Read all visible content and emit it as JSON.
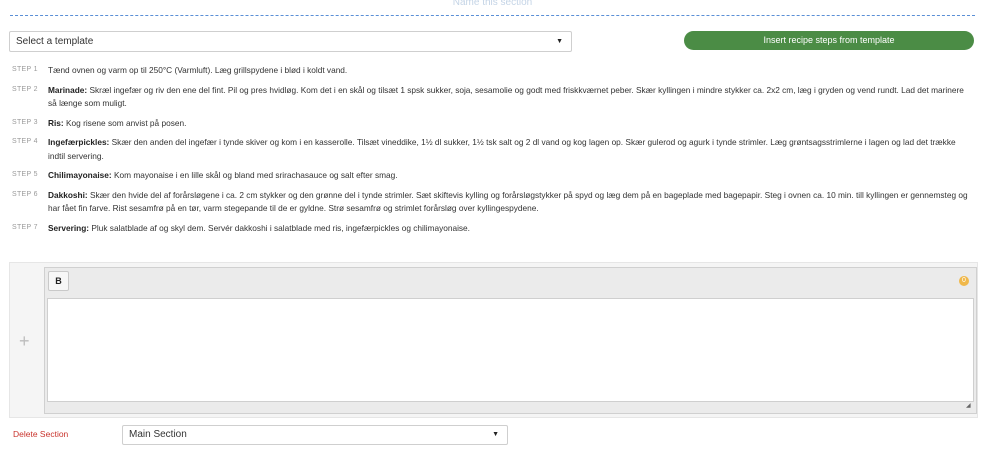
{
  "section": {
    "name_placeholder": "Name this section"
  },
  "template": {
    "selected": "Select a template",
    "insert_label": "Insert recipe steps from template"
  },
  "steps": [
    {
      "label": "STEP 1",
      "title": "",
      "text": "Tænd ovnen og varm op til 250°C (Varmluft). Læg grillspydene i blød i koldt vand."
    },
    {
      "label": "STEP 2",
      "title": "Marinade:",
      "text": "Skræl ingefær og riv den ene del fint. Pil og pres hvidløg. Kom det i en skål og tilsæt 1 spsk sukker, soja, sesamolie og godt med friskkværnet peber. Skær kyllingen i mindre stykker ca. 2x2 cm, læg i gryden og vend rundt. Lad det marinere så længe som muligt."
    },
    {
      "label": "STEP 3",
      "title": "Ris:",
      "text": "Kog risene som anvist på posen."
    },
    {
      "label": "STEP 4",
      "title": "Ingefærpickles:",
      "text": "Skær den anden del ingefær i tynde skiver og kom i en kasserolle. Tilsæt vineddike, 1½ dl sukker, 1½ tsk salt og 2 dl vand og kog lagen op. Skær gulerod og agurk i tynde strimler. Læg grøntsagsstrimlerne i lagen og lad det trække indtil servering."
    },
    {
      "label": "STEP 5",
      "title": "Chilimayonaise:",
      "text": "Kom mayonaise i en lille skål og bland med srirachasauce og salt efter smag."
    },
    {
      "label": "STEP 6",
      "title": "Dakkoshi:",
      "text": "Skær den hvide del af forårsløgene i ca. 2 cm stykker og den grønne del i tynde strimler. Sæt skiftevis kylling og forårsløgstykker på spyd og læg dem på en bageplade med bagepapir. Steg i ovnen ca. 10 min. till kyllingen er gennemsteg og har fået fin farve. Rist sesamfrø på en tør, varm stegepande til de er gyldne. Strø sesamfrø og strimlet forårsløg over kyllingespydene."
    },
    {
      "label": "STEP 7",
      "title": "Servering:",
      "text": "Pluk salatblade af og skyl dem. Servér dakkoshi i salatblade med ris, ingefærpickles og chilimayonaise."
    }
  ],
  "editor": {
    "bold_label": "B",
    "char_count": "0",
    "add_symbol": "+"
  },
  "footer": {
    "delete_label": "Delete Section",
    "section_selected": "Main Section"
  },
  "icons": {
    "dropdown": "chevron-down-icon",
    "add": "plus-icon",
    "resize": "resize-handle-icon"
  },
  "colors": {
    "accent_green": "#4b8c45",
    "danger": "#c9342d",
    "counter": "#f0b84a",
    "divider": "#5a8fd6"
  }
}
